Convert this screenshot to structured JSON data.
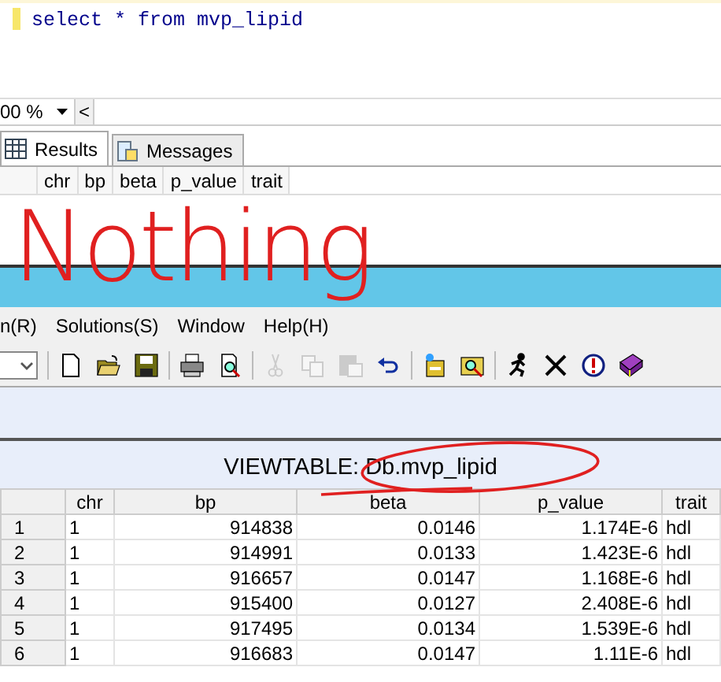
{
  "editor": {
    "query": "select * from mvp_lipid"
  },
  "zoom": {
    "value": "00 %",
    "scroll_button": "<"
  },
  "result_tabs": [
    {
      "label": "Results",
      "selected": true
    },
    {
      "label": "Messages",
      "selected": false
    }
  ],
  "result_columns": [
    "chr",
    "bp",
    "beta",
    "p_value",
    "trait"
  ],
  "annotation": {
    "text": "Nothing"
  },
  "menu": [
    "n(R)",
    "Solutions(S)",
    "Window",
    "Help(H)"
  ],
  "toolbar": [
    [
      {
        "kind": "new",
        "disabled": false
      },
      {
        "kind": "open",
        "disabled": false
      },
      {
        "kind": "save",
        "disabled": false
      }
    ],
    [
      {
        "kind": "print",
        "disabled": false
      },
      {
        "kind": "preview",
        "disabled": false
      }
    ],
    [
      {
        "kind": "cut",
        "disabled": true
      },
      {
        "kind": "copy",
        "disabled": true
      },
      {
        "kind": "paste",
        "disabled": true
      },
      {
        "kind": "undo",
        "disabled": false
      }
    ],
    [
      {
        "kind": "wizard",
        "disabled": false
      },
      {
        "kind": "find",
        "disabled": false
      }
    ],
    [
      {
        "kind": "run",
        "disabled": false
      },
      {
        "kind": "close",
        "disabled": false
      },
      {
        "kind": "info",
        "disabled": false
      },
      {
        "kind": "help",
        "disabled": false
      }
    ]
  ],
  "viewtable": {
    "title": "VIEWTABLE: Db.mvp_lipid",
    "columns": [
      "chr",
      "bp",
      "beta",
      "p_value",
      "trait"
    ],
    "rows": [
      {
        "index": "1",
        "cells": [
          "1",
          "914838",
          "0.0146",
          "1.174E-6",
          "hdl"
        ]
      },
      {
        "index": "2",
        "cells": [
          "1",
          "914991",
          "0.0133",
          "1.423E-6",
          "hdl"
        ]
      },
      {
        "index": "3",
        "cells": [
          "1",
          "916657",
          "0.0147",
          "1.168E-6",
          "hdl"
        ]
      },
      {
        "index": "4",
        "cells": [
          "1",
          "915400",
          "0.0127",
          "2.408E-6",
          "hdl"
        ]
      },
      {
        "index": "5",
        "cells": [
          "1",
          "917495",
          "0.0134",
          "1.539E-6",
          "hdl"
        ]
      },
      {
        "index": "6",
        "cells": [
          "1",
          "916683",
          "0.0147",
          "1.11E-6",
          "hdl"
        ]
      }
    ]
  }
}
